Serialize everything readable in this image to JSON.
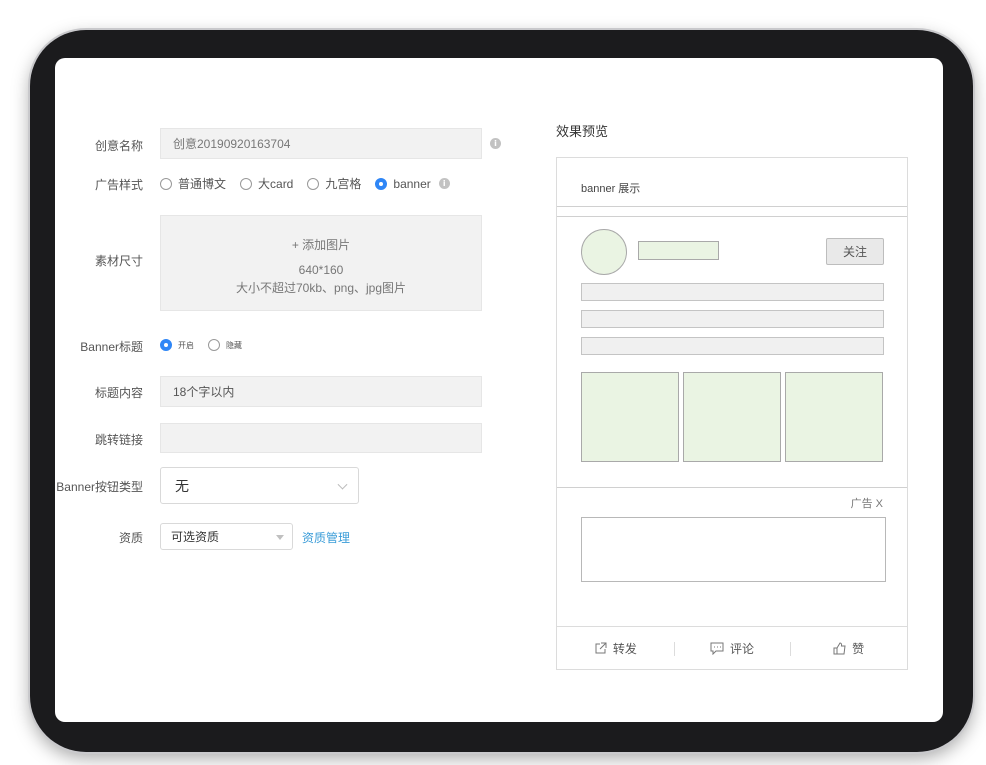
{
  "form": {
    "name": {
      "label": "创意名称",
      "value": "创意20190920163704"
    },
    "style": {
      "label": "广告样式",
      "options": [
        "普通博文",
        "大card",
        "九宫格",
        "banner"
      ],
      "selected": "banner"
    },
    "material": {
      "label": "素材尺寸",
      "add_label": "+ 添加图片",
      "size": "640*160",
      "hint": "大小不超过70kb、png、jpg图片"
    },
    "banner_title": {
      "label": "Banner标题",
      "options": [
        "开启",
        "隐藏"
      ],
      "selected": "开启"
    },
    "title_content": {
      "label": "标题内容",
      "placeholder": "18个字以内"
    },
    "jump_link": {
      "label": "跳转链接",
      "value": ""
    },
    "button_type": {
      "label": "Banner按钮类型",
      "value": "无"
    },
    "qualification": {
      "label": "资质",
      "value": "可选资质",
      "manage_link": "资质管理"
    }
  },
  "preview": {
    "title": "效果预览",
    "header": "banner 展示",
    "follow": "关注",
    "ad_tag": "广告 X",
    "actions": [
      "转发",
      "评论",
      "赞"
    ]
  },
  "colors": {
    "accent": "#2f86f6",
    "link": "#3a9cd8",
    "placeholder_green": "#eaf4e3"
  }
}
